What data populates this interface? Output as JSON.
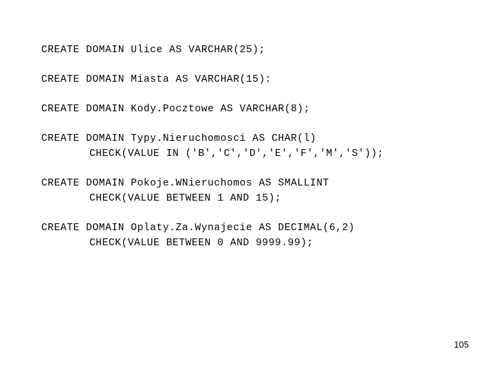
{
  "slide": {
    "background_color": "#ffffff",
    "text_color": "#000000",
    "page_number": "105",
    "statements": [
      {
        "name": "create-domain-ulice",
        "lines": [
          {
            "text": "CREATE DOMAIN Ulice AS VARCHAR(25);",
            "indent": false
          }
        ]
      },
      {
        "name": "create-domain-miasta",
        "lines": [
          {
            "text": "CREATE DOMAIN Miasta AS VARCHAR(15):",
            "indent": false
          }
        ]
      },
      {
        "name": "create-domain-kodypocztowe",
        "lines": [
          {
            "text": "CREATE DOMAIN Kody.Pocztowe AS VARCHAR(8);",
            "indent": false
          }
        ]
      },
      {
        "name": "create-domain-typynieruchomosci",
        "lines": [
          {
            "text": "CREATE DOMAIN Typy.Nieruchomosci AS CHAR(l)",
            "indent": false
          },
          {
            "text": "CHECK(VALUE IN ('B','C','D','E','F','M','S'));",
            "indent": true
          }
        ]
      },
      {
        "name": "create-domain-pokojewnieruchomos",
        "lines": [
          {
            "text": "CREATE DOMAIN Pokoje.WNieruchomos AS SMALLINT",
            "indent": false
          },
          {
            "text": "CHECK(VALUE BETWEEN 1 AND 15);",
            "indent": true
          }
        ]
      },
      {
        "name": "create-domain-oplatyzawynajecie",
        "lines": [
          {
            "text": "CREATE DOMAIN Oplaty.Za.Wynajecie AS DECIMAL(6,2)",
            "indent": false
          },
          {
            "text": "CHECK(VALUE BETWEEN 0 AND 9999.99);",
            "indent": true
          }
        ]
      }
    ]
  }
}
